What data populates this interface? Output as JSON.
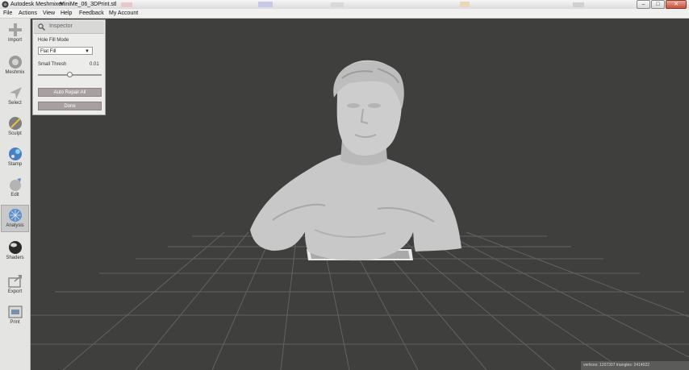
{
  "titlebar": {
    "app_name": "Autodesk Meshmixer",
    "file_name": "MiniMe_06_3DPrint.stl",
    "buttons": [
      "–",
      "□",
      "✕"
    ]
  },
  "menu": [
    "File",
    "Actions",
    "View",
    "Help",
    "Feedback",
    "My Account"
  ],
  "tools": [
    {
      "label": "Import",
      "icon": "plus-icon"
    },
    {
      "label": "Meshmix",
      "icon": "meshmix-icon"
    },
    {
      "label": "Select",
      "icon": "select-arrow-icon"
    },
    {
      "label": "Sculpt",
      "icon": "sculpt-brush-icon"
    },
    {
      "label": "Stamp",
      "icon": "stamp-icon"
    },
    {
      "label": "Edit",
      "icon": "edit-icon"
    },
    {
      "label": "Analysis",
      "icon": "analysis-icon",
      "active": true
    },
    {
      "label": "Shaders",
      "icon": "shaders-sphere-icon"
    },
    {
      "label": "Export",
      "icon": "export-icon"
    },
    {
      "label": "Print",
      "icon": "print-icon"
    }
  ],
  "inspector": {
    "title": "Inspector",
    "hole_fill_label": "Hole Fill Mode",
    "hole_fill_value": "Flat Fill",
    "small_thresh_label": "Small Thresh",
    "small_thresh_value": "0.01",
    "small_thresh_level": 0.5,
    "auto_repair_label": "Auto Repair All",
    "done_label": "Done"
  },
  "status": {
    "text": "vertices: 1207307 triangles: 2414022"
  },
  "colors": {
    "viewport_bg": "#3f3f3d",
    "grid": "#6a6a68",
    "mesh": "#c9c9c9",
    "button": "#a89fa0"
  }
}
